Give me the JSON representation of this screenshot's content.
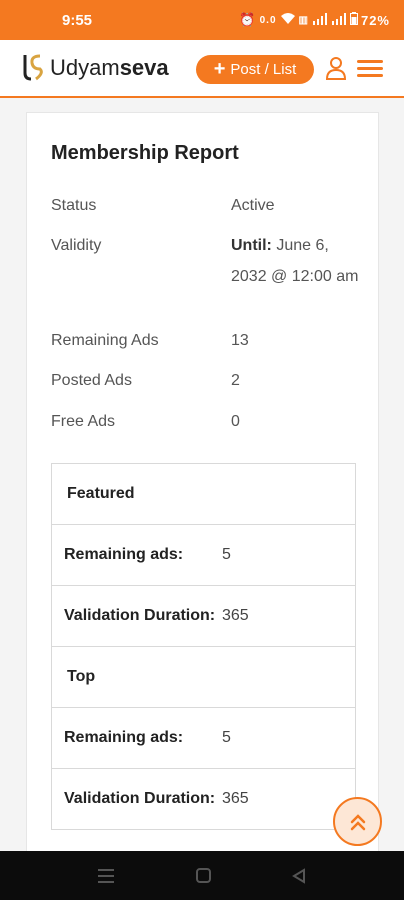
{
  "status_bar": {
    "time": "9:55",
    "battery": "72%",
    "icons": [
      "alarm-icon",
      "data-icon",
      "wifi-icon",
      "volte-icon",
      "signal-icon",
      "signal-icon",
      "battery-icon"
    ]
  },
  "header": {
    "brand_regular": "Udyam",
    "brand_bold": "seva",
    "post_button_label": "Post / List"
  },
  "membership": {
    "title": "Membership Report",
    "rows": [
      {
        "label": "Status",
        "value": "Active"
      },
      {
        "label": "Validity",
        "value_prefix": "Until:",
        "value": " June 6, 2032 @ 12:00 am"
      },
      {
        "label": "Remaining Ads",
        "value": "13"
      },
      {
        "label": "Posted Ads",
        "value": "2"
      },
      {
        "label": "Free Ads",
        "value": "0"
      }
    ]
  },
  "ad_types": [
    {
      "name": "Featured",
      "remaining_label": "Remaining ads:",
      "remaining_value": "5",
      "duration_label": "Validation Duration:",
      "duration_value": "365"
    },
    {
      "name": "Top",
      "remaining_label": "Remaining ads:",
      "remaining_value": "5",
      "duration_label": "Validation Duration:",
      "duration_value": "365"
    }
  ],
  "colors": {
    "accent": "#f47920",
    "nav_bar": "#0c0c0c"
  }
}
